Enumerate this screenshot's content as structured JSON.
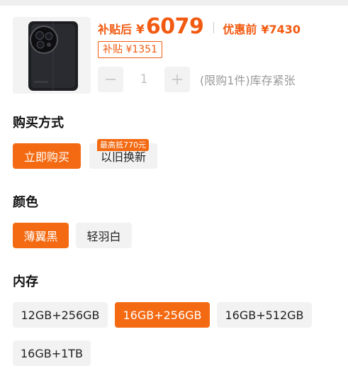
{
  "product": {
    "image_icon": "foldable-phone-black"
  },
  "price": {
    "after_subsidy_label": "补贴后",
    "currency": "¥",
    "after_subsidy_value": "6079",
    "before_discount_label": "优惠前",
    "before_discount_value": "¥7430",
    "subsidy_text": "补贴 ¥1351"
  },
  "quantity": {
    "minus_icon": "minus-icon",
    "plus_icon": "plus-icon",
    "value": "1",
    "limit_text": "(限购1件)库存紧张"
  },
  "purchase_method": {
    "title": "购买方式",
    "options": [
      "立即购买",
      "以旧换新"
    ],
    "selected": "立即购买",
    "trade_in_badge": "最高抵770元"
  },
  "color": {
    "title": "颜色",
    "options": [
      "薄翼黑",
      "轻羽白"
    ],
    "selected": "薄翼黑"
  },
  "storage": {
    "title": "内存",
    "options": [
      "12GB+256GB",
      "16GB+256GB",
      "16GB+512GB",
      "16GB+1TB"
    ],
    "selected": "16GB+256GB"
  },
  "theme": {
    "accent": "#f46a12",
    "price_color": "#f25a10",
    "option_bg": "#f2f2f2"
  }
}
